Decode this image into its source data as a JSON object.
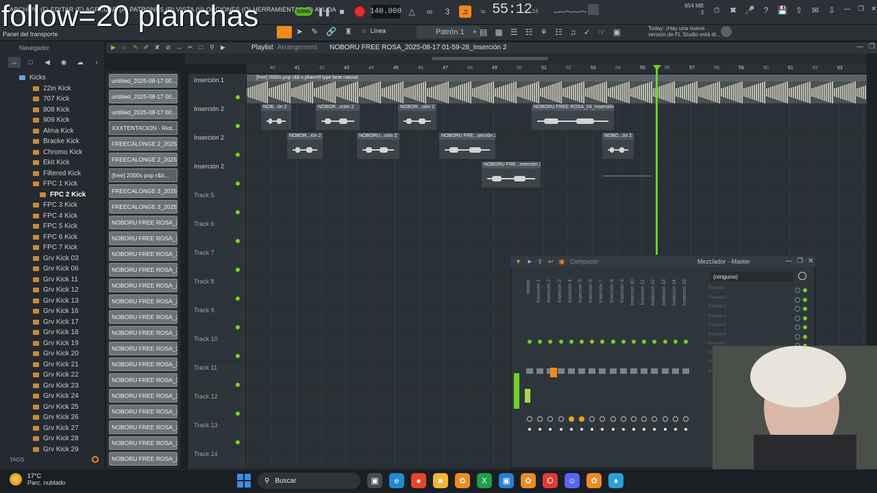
{
  "overlay_text": "follow=20 planchas",
  "menu": {
    "items": [
      "ARCHIVO (F)",
      "EDITAR (E)",
      "AGREGAR (A)",
      "PATRONES (P)",
      "VISTA (V)",
      "OPCIONES (O)",
      "HERRAMIENTAS (T)",
      "AYUDA"
    ]
  },
  "transport": {
    "mode": "SONG",
    "tempo": "140.000",
    "time_main": "55:12",
    "time_small": "14",
    "memory": "654 MB",
    "memory_line2": "3"
  },
  "toolbar2": {
    "panel_label": "Panel del transporte",
    "snap_label": "Línea",
    "pattern_label": "Patrón 1",
    "news_line1": "Today: ¡Hay una nueva",
    "news_line2": "versión de FL Studio está di..."
  },
  "browser": {
    "header": "Navegador",
    "root_folder": "Kicks",
    "items": [
      "22in Kick",
      "707 Kick",
      "808 Kick",
      "909 Kick",
      "Alma Kick",
      "Bracke Kick",
      "Chromo Kick",
      "Ekit Kick",
      "Filtered Kick",
      "FPC 1 Kick",
      "FPC 2 Kick",
      "FPC 3 Kick",
      "FPC 4 Kick",
      "FPC 5 Kick",
      "FPC 6 Kick",
      "FPC 7 Kick",
      "Grv Kick 03",
      "Grv Kick 06",
      "Grv Kick 11",
      "Grv Kick 12",
      "Grv Kick 13",
      "Grv Kick 16",
      "Grv Kick 17",
      "Grv Kick 18",
      "Grv Kick 19",
      "Grv Kick 20",
      "Grv Kick 21",
      "Grv Kick 22",
      "Grv Kick 23",
      "Grv Kick 24",
      "Grv Kick 25",
      "Grv Kick 26",
      "Grv Kick 27",
      "Grv Kick 28",
      "Grv Kick 29"
    ],
    "selected": "FPC 2 Kick",
    "tags_label": "TAGS"
  },
  "channels": [
    "untitled_2025-08-17 00...",
    "untitled_2025-08-17 00...",
    "untitled_2025-08-17 00...",
    "XXXTENTACION - Riot...",
    "FREECALONGE 2_2025-08...",
    "FREECALONGE 2_2025-08...",
    "[free] 2000s pop r&b...",
    "FREECALONGE 3_2025-08...",
    "FREECALONGE 3_2025-08...",
    "NOBORU FREE ROSA_202...",
    "NOBORU FREE ROSA_202...",
    "NOBORU FREE ROSA_202...",
    "NOBORU FREE ROSA_202...",
    "NOBORU FREE ROSA_202...",
    "NOBORU FREE ROSA_202...",
    "NOBORU FREE ROSA_202...",
    "NOBORU FREE ROSA_202...",
    "NOBORU FREE ROSA_202...",
    "NOBORU FREE ROSA_202...",
    "NOBORU FREE ROSA_202...",
    "NOBORU FREE ROSA_202...",
    "NOBORU FREE ROSA_202...",
    "NOBORU FREE ROSA_202...",
    "NOBORU FREE ROSA_202...",
    "NOBORU FREE ROSA_202..."
  ],
  "playlist": {
    "title": "Playlist",
    "subtitle": "Arrangement",
    "name": "NOBORU FREE ROSA_2025-08-17 01-59-28_Inserción 2",
    "ruler": [
      "40",
      "41",
      "42",
      "43",
      "44",
      "45",
      "46",
      "47",
      "48",
      "49",
      "50",
      "51",
      "52",
      "53",
      "54",
      "55",
      "56",
      "57",
      "58",
      "59",
      "60",
      "61",
      "62",
      "63"
    ],
    "tracks": [
      "Inserción 1",
      "Inserción 2",
      "Inserción 2",
      "Inserción 2",
      "Track 5",
      "Track 6",
      "Track 7",
      "Track 8",
      "Track 9",
      "Track 10",
      "Track 11",
      "Track 12",
      "Track 13",
      "Track 14"
    ],
    "big_clip_label": "[free] 2000s pop r&b x pharrell type beat  natural",
    "clips_row2": [
      "NOB...ón 2",
      "NOBOR...rción 2",
      "NOBOR...ción 2",
      "NOBORU FREE ROSA_04_Inserción 2"
    ],
    "clips_row3": [
      "NOBOR...ión 2",
      "NOBORU...ción 2",
      "NOBORU FRE...serción 2",
      "NOBO...ón 2"
    ],
    "clips_row4": [
      "NOBORU FRE...nserción 2"
    ]
  },
  "mixer": {
    "title": "Mezclador - Master",
    "mode": "Compacto",
    "slot_value": "(ninguno)",
    "strips": [
      "Master",
      "Inserción 1",
      "Inserción 2",
      "Inserción 3",
      "Inserción 4",
      "Inserción 5",
      "Inserción 6",
      "Inserción 7",
      "Inserción 8",
      "Inserción 9",
      "Inserción 10",
      "Inserción 11",
      "Inserción 12",
      "Inserción 13",
      "Inserción 14",
      "Inserción 15"
    ],
    "slots": [
      "Ranura 1",
      "Ranura 2",
      "Ranura 3",
      "Ranura 4",
      "Ranura 5",
      "Ranura 6",
      "Ranura 7",
      "Ranura 8",
      "Ranura 9",
      "Ranura 10"
    ]
  },
  "taskbar": {
    "temp": "17°C",
    "weather": "Parc. nublado",
    "search": "Buscar"
  },
  "colors": {
    "accent_green": "#6fd02a",
    "accent_orange": "#f08a20",
    "record_red": "#e0303a"
  }
}
